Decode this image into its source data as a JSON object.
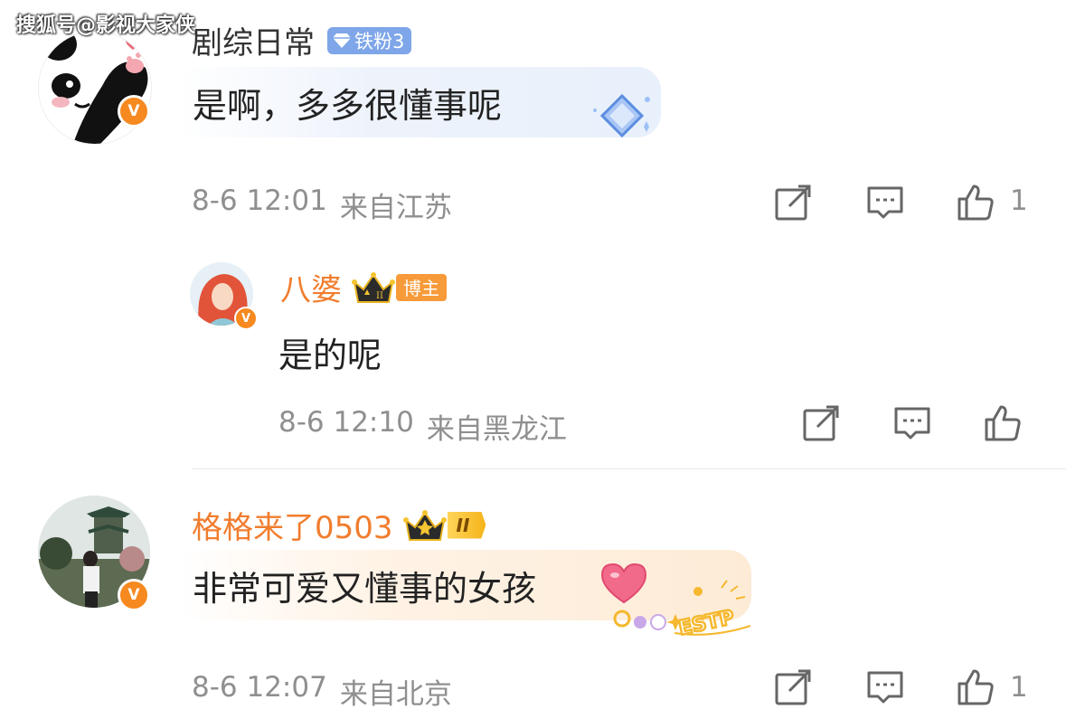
{
  "watermark": "搜狐号@影视大家侠",
  "comments": [
    {
      "username": "剧综日常",
      "badge": "铁粉3",
      "text": "是啊，多多很懂事呢",
      "time": "8-6 12:01",
      "location": "来自江苏",
      "likes": "1"
    },
    {
      "username": "八婆",
      "badge": "博主",
      "text": "是的呢",
      "time": "8-6 12:10",
      "location": "来自黑龙江",
      "likes": ""
    },
    {
      "username": "格格来了0503",
      "badge": "II",
      "text": "非常可爱又懂事的女孩",
      "time": "8-6 12:07",
      "location": "来自北京",
      "likes": "1",
      "sticker": "ESTP"
    }
  ],
  "verified_mark": "V",
  "crown_level": "II",
  "colors": {
    "username_orange": "#f17d2e",
    "verified_orange": "#f6891f",
    "meta_gray": "#8f8f8f",
    "fan_badge_blue": "#7ea6e8",
    "host_badge_orange": "#f79a3a"
  }
}
